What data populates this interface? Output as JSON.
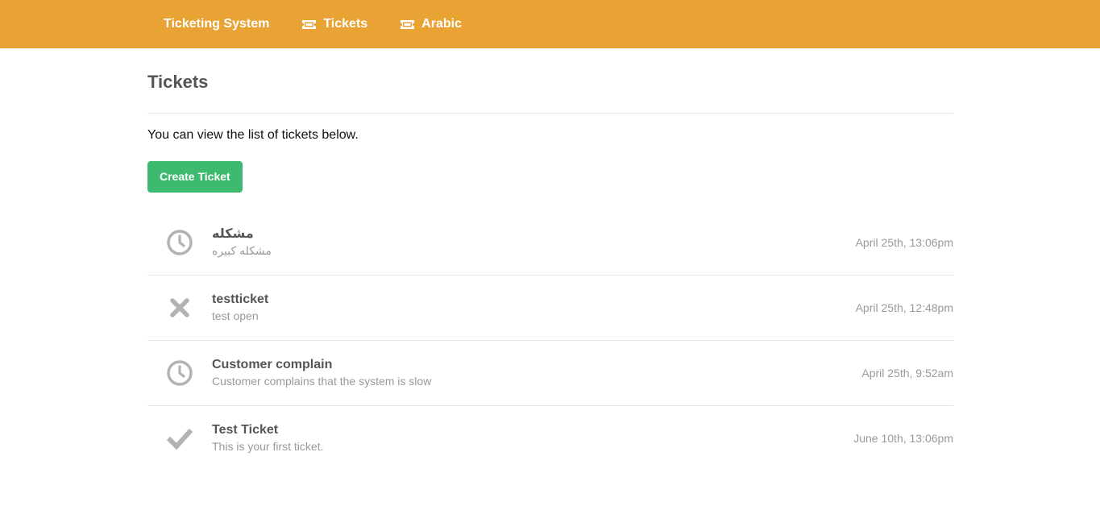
{
  "colors": {
    "navbar": "#e9a334",
    "create_button": "#3dba6f",
    "status_icon": "#b3b3b3"
  },
  "navbar": {
    "brand": "Ticketing System",
    "items": [
      {
        "label": "Tickets",
        "icon": "ticket-icon"
      },
      {
        "label": "Arabic",
        "icon": "ticket-icon"
      }
    ]
  },
  "main": {
    "title": "Tickets",
    "intro": "You can view the list of tickets below.",
    "create_button_label": "Create Ticket"
  },
  "tickets": [
    {
      "status_icon": "clock-icon",
      "title": "مشكله",
      "description": "مشكله كبيره",
      "date": "April 25th, 13:06pm"
    },
    {
      "status_icon": "close-icon",
      "title": "testticket",
      "description": "test open",
      "date": "April 25th, 12:48pm"
    },
    {
      "status_icon": "clock-icon",
      "title": "Customer complain",
      "description": "Customer complains that the system is slow",
      "date": "April 25th, 9:52am"
    },
    {
      "status_icon": "check-icon",
      "title": "Test Ticket",
      "description": "This is your first ticket.",
      "date": "June 10th, 13:06pm"
    }
  ]
}
